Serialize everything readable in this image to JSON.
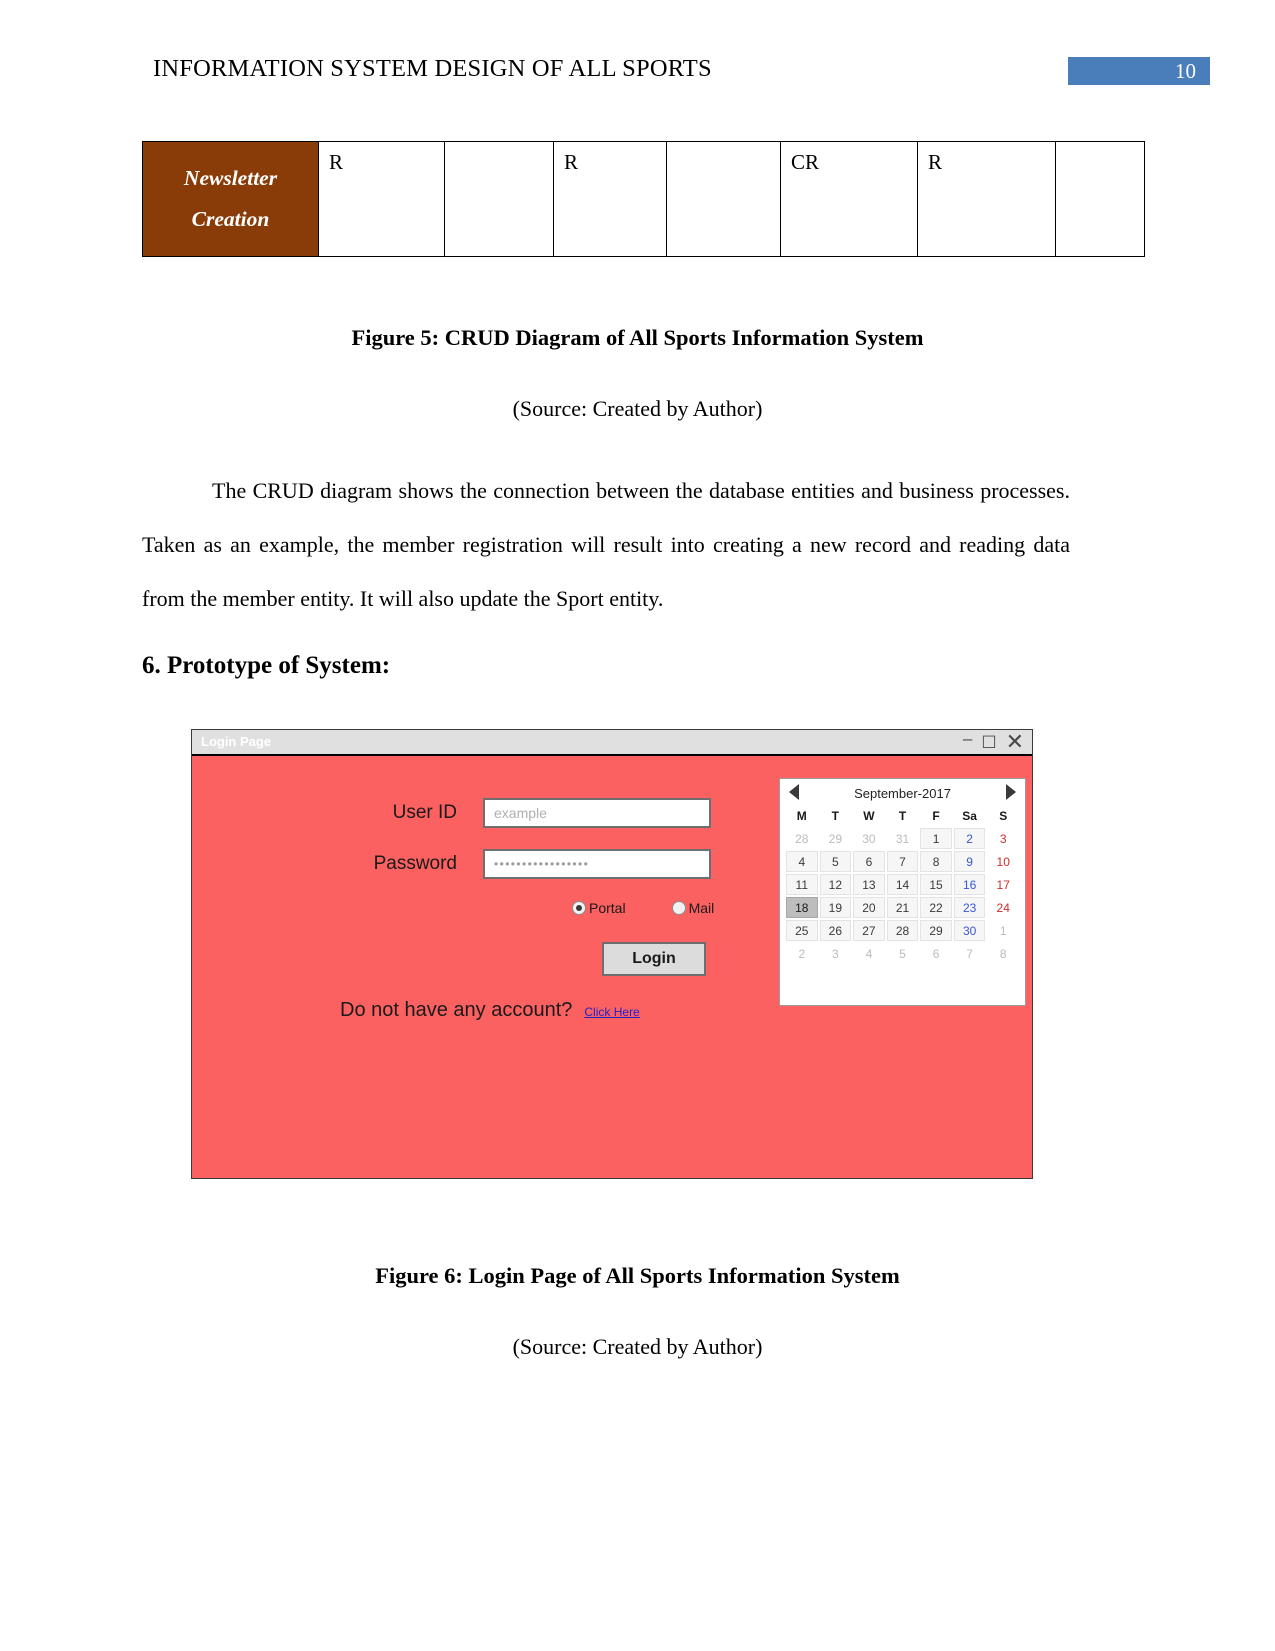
{
  "header": {
    "title": "INFORMATION SYSTEM DESIGN OF ALL SPORTS",
    "page_number": "10",
    "page_number_color": "#4a7ebb"
  },
  "crud_table": {
    "row_label_line1": "Newsletter",
    "row_label_line2": "Creation",
    "label_bg_color": "#8a3c08",
    "cells": [
      "R",
      "",
      "R",
      "",
      "CR",
      "R",
      ""
    ]
  },
  "figure5": {
    "caption": "Figure 5: CRUD Diagram of All Sports Information System",
    "source": "(Source: Created by Author)"
  },
  "paragraph": "The CRUD diagram shows the connection between the database entities and business processes. Taken as an example, the member registration will result into creating a new record and reading data from the member entity. It will also update the Sport entity.",
  "section_heading": "6. Prototype of System:",
  "login_window": {
    "title": "Login Page",
    "background_color": "#fc6161",
    "titlebar_color": "#e0e0e0",
    "controls": {
      "minimize": "–",
      "maximize": "☐",
      "close": "✕"
    },
    "fields": [
      {
        "label": "User ID",
        "value": "",
        "placeholder": "example"
      },
      {
        "label": "Password",
        "value": "•••••••••••••••••",
        "placeholder": ""
      }
    ],
    "radio_options": [
      {
        "label": "Portal",
        "selected": true
      },
      {
        "label": "Mail",
        "selected": false
      }
    ],
    "login_button_label": "Login",
    "signup_prompt": "Do not have any account?",
    "signup_link_label": "Click Here",
    "signup_link_color": "#2222cc"
  },
  "calendar": {
    "title": "September-2017",
    "prev_label": "◀",
    "next_label": "▶",
    "weekdays": [
      "M",
      "T",
      "W",
      "T",
      "F",
      "Sa",
      "S"
    ],
    "selected_day": "18",
    "weeks": [
      [
        {
          "d": "28",
          "muted": true
        },
        {
          "d": "29",
          "muted": true
        },
        {
          "d": "30",
          "muted": true
        },
        {
          "d": "31",
          "muted": true
        },
        {
          "d": "1",
          "muted": false
        },
        {
          "d": "2",
          "muted": false
        },
        {
          "d": "3",
          "muted": false
        }
      ],
      [
        {
          "d": "4",
          "muted": false
        },
        {
          "d": "5",
          "muted": false
        },
        {
          "d": "6",
          "muted": false
        },
        {
          "d": "7",
          "muted": false
        },
        {
          "d": "8",
          "muted": false
        },
        {
          "d": "9",
          "muted": false
        },
        {
          "d": "10",
          "muted": false
        }
      ],
      [
        {
          "d": "11",
          "muted": false
        },
        {
          "d": "12",
          "muted": false
        },
        {
          "d": "13",
          "muted": false
        },
        {
          "d": "14",
          "muted": false
        },
        {
          "d": "15",
          "muted": false
        },
        {
          "d": "16",
          "muted": false
        },
        {
          "d": "17",
          "muted": false
        }
      ],
      [
        {
          "d": "18",
          "muted": false
        },
        {
          "d": "19",
          "muted": false
        },
        {
          "d": "20",
          "muted": false
        },
        {
          "d": "21",
          "muted": false
        },
        {
          "d": "22",
          "muted": false
        },
        {
          "d": "23",
          "muted": false
        },
        {
          "d": "24",
          "muted": false
        }
      ],
      [
        {
          "d": "25",
          "muted": false
        },
        {
          "d": "26",
          "muted": false
        },
        {
          "d": "27",
          "muted": false
        },
        {
          "d": "28",
          "muted": false
        },
        {
          "d": "29",
          "muted": false
        },
        {
          "d": "30",
          "muted": false
        },
        {
          "d": "1",
          "muted": true
        }
      ],
      [
        {
          "d": "2",
          "muted": true
        },
        {
          "d": "3",
          "muted": true
        },
        {
          "d": "4",
          "muted": true
        },
        {
          "d": "5",
          "muted": true
        },
        {
          "d": "6",
          "muted": true
        },
        {
          "d": "7",
          "muted": true
        },
        {
          "d": "8",
          "muted": true
        }
      ]
    ]
  },
  "figure6": {
    "caption": "Figure 6: Login Page of All Sports Information System",
    "source": "(Source: Created by Author)"
  }
}
